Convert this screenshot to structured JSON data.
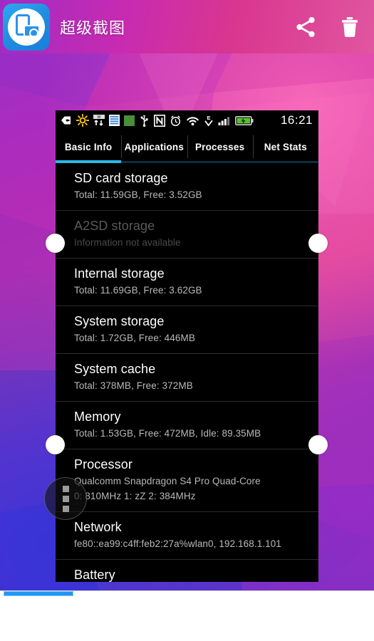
{
  "app": {
    "title": "超级截图",
    "icon": "screenshot-app-icon",
    "brand_color": "#2a93e8",
    "actions": [
      {
        "name": "share",
        "icon": "share-icon",
        "label": "Share"
      },
      {
        "name": "delete",
        "icon": "trash-icon",
        "label": "Delete"
      }
    ]
  },
  "screenshot": {
    "statusbar": {
      "time": "16:21",
      "icons": [
        "back-arrow-icon",
        "brightness-icon",
        "data-sync-icon",
        "list-icon",
        "green-square-icon",
        "usb-icon",
        "nfc-icon",
        "alarm-icon",
        "wifi-icon",
        "edge-data-icon",
        "signal-bars-icon",
        "battery-charging-icon"
      ]
    },
    "tabs": [
      {
        "label": "Basic Info",
        "active": true
      },
      {
        "label": "Applications",
        "active": false
      },
      {
        "label": "Processes",
        "active": false
      },
      {
        "label": "Net Stats",
        "active": false
      }
    ],
    "rows": [
      {
        "title": "SD card storage",
        "detail": "Total: 11.59GB, Free: 3.52GB",
        "dim": false
      },
      {
        "title": "A2SD storage",
        "detail": "Information not available",
        "dim": true
      },
      {
        "title": "Internal storage",
        "detail": "Total: 11.69GB, Free: 3.62GB",
        "dim": false
      },
      {
        "title": "System storage",
        "detail": "Total: 1.72GB, Free: 446MB",
        "dim": false
      },
      {
        "title": "System cache",
        "detail": "Total: 378MB, Free: 372MB",
        "dim": false
      },
      {
        "title": "Memory",
        "detail": "Total: 1.53GB, Free: 472MB, Idle: 89.35MB",
        "dim": false
      },
      {
        "title": "Processor",
        "detail": "Qualcomm Snapdragon S4 Pro Quad-Core",
        "detail2": "0: 810MHz  1: zZ  2: 384MHz",
        "dim": false
      },
      {
        "title": "Network",
        "detail": "fe80::ea99:c4ff:feb2:27a%wlan0, 192.168.1.101",
        "dim": false
      },
      {
        "title": "Battery",
        "detail": "",
        "dim": false
      }
    ]
  },
  "editor": {
    "handles": [
      "crop-handle-top-left",
      "crop-handle-top-right",
      "crop-handle-bottom-left",
      "crop-handle-bottom-right"
    ],
    "fab": "overflow-menu-button",
    "progress_color": "#2196f3"
  }
}
